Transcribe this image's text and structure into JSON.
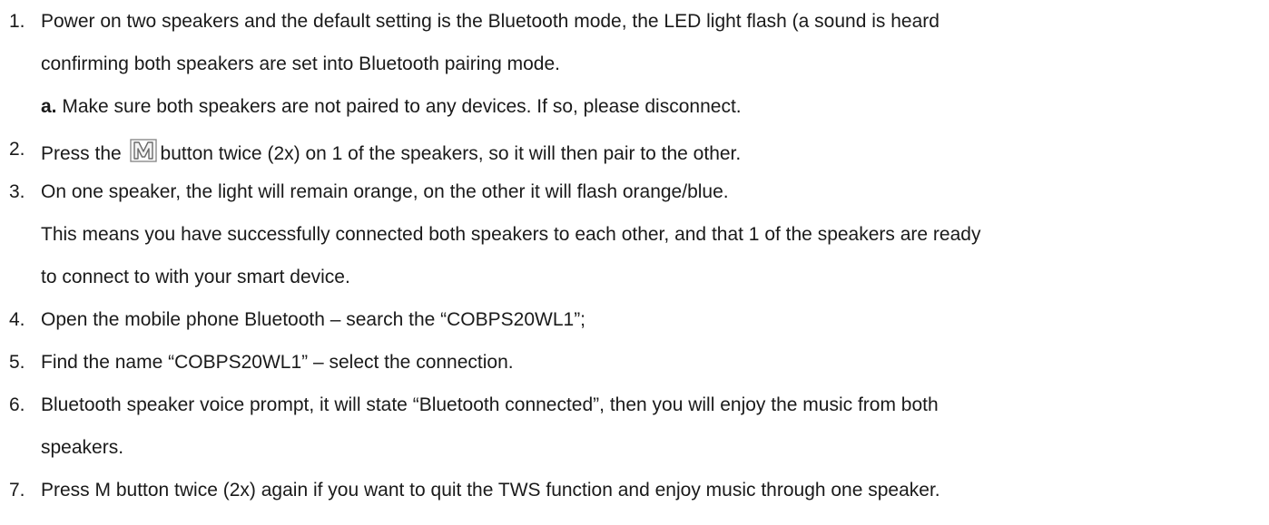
{
  "steps": [
    {
      "number": "1.",
      "lines": [
        "Power on two speakers and the default setting is the Bluetooth mode, the LED light flash (a sound is heard",
        "confirming both speakers are set into Bluetooth pairing mode."
      ],
      "sub": {
        "label": "a.",
        "text": " Make sure both speakers are not paired to any devices. If so, please disconnect."
      }
    },
    {
      "number": "2.",
      "before_icon": "Press the ",
      "icon": "m-button-icon",
      "after_icon": "button twice (2x) on 1 of the speakers, so it will then pair to the other."
    },
    {
      "number": "3.",
      "lines": [
        "On one speaker, the light will remain orange, on the other it will flash orange/blue.",
        "This means you have successfully connected both speakers to each other, and that 1 of the speakers are ready",
        "to connect to with your smart device."
      ]
    },
    {
      "number": "4.",
      "lines": [
        "Open the mobile phone Bluetooth – search the “COBPS20WL1”;"
      ]
    },
    {
      "number": "5.",
      "lines": [
        "Find the name “COBPS20WL1” – select the connection."
      ]
    },
    {
      "number": "6.",
      "lines": [
        "Bluetooth speaker voice prompt, it will state “Bluetooth connected”, then you will enjoy the music from both",
        "speakers."
      ]
    },
    {
      "number": "7.",
      "lines": [
        "Press M button twice (2x) again if you want to quit the TWS function and enjoy music through one speaker."
      ]
    }
  ]
}
